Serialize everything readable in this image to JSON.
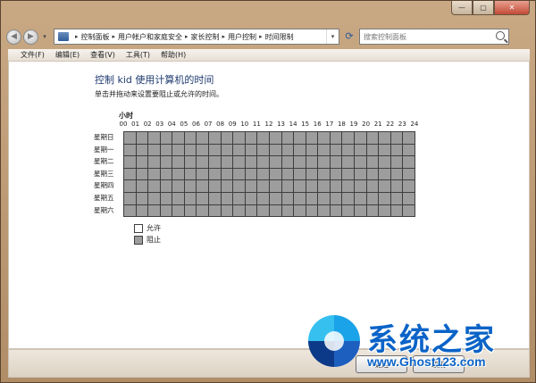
{
  "window": {
    "caption_buttons": {
      "minimize": "—",
      "maximize": "▢",
      "close": "✕"
    }
  },
  "nav": {
    "back_icon": "back-arrow-icon",
    "forward_icon": "forward-arrow-icon",
    "dropdown": "▾",
    "breadcrumbs": [
      "控制面板",
      "用户帐户和家庭安全",
      "家长控制",
      "用户控制",
      "时间限制"
    ],
    "search_placeholder": "搜索控制面板"
  },
  "menu": [
    "文件(F)",
    "编辑(E)",
    "查看(V)",
    "工具(T)",
    "帮助(H)"
  ],
  "page": {
    "title": "控制 kid 使用计算机的时间",
    "instruction": "单击并拖动来设置要阻止或允许的时间。",
    "hour_caption": "小时"
  },
  "schedule": {
    "hours": [
      "00",
      "01",
      "02",
      "03",
      "04",
      "05",
      "06",
      "07",
      "08",
      "09",
      "10",
      "11",
      "12",
      "13",
      "14",
      "15",
      "16",
      "17",
      "18",
      "19",
      "20",
      "21",
      "22",
      "23",
      "24"
    ],
    "days": [
      "星期日",
      "星期一",
      "星期二",
      "星期三",
      "星期四",
      "星期五",
      "星期六"
    ],
    "allowed_rows": [
      "000000000000000000000000",
      "000000000000000000000000",
      "000000000000000000000000",
      "000000000000000000000000",
      "000000000000000000000000",
      "000000000000000000000000",
      "000000000000000000000000"
    ]
  },
  "legend": {
    "allowed": "允许",
    "blocked": "阻止"
  },
  "footer": {
    "ok": "确定",
    "cancel": "取消"
  },
  "watermark": {
    "title": "系统之家",
    "url": "www.Ghost123.com"
  },
  "colors": {
    "blocked": "#9d9d9d",
    "allowed": "#ffffff",
    "title_blue": "#1e3a6e"
  }
}
